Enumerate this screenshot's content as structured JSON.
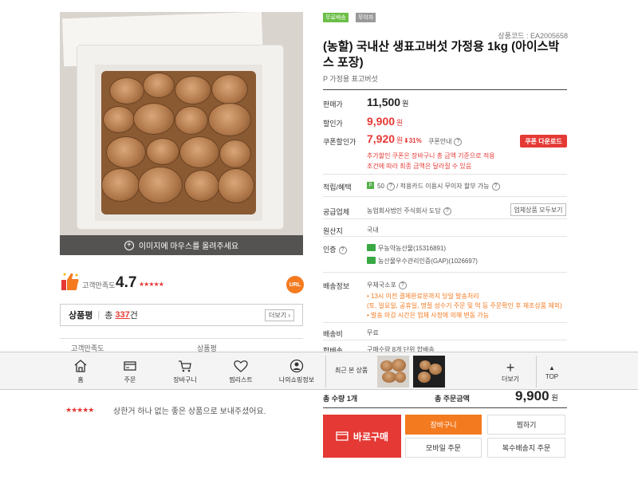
{
  "image": {
    "caption": "이미지에 마우스를 올려주세요"
  },
  "rating": {
    "label": "고객만족도",
    "value": "4.7",
    "stars": "★★★★★",
    "url_badge": "URL"
  },
  "reviews": {
    "title": "상품평",
    "total_prefix": "총",
    "count": "337",
    "suffix": "건",
    "more_label": "더보기 ›",
    "col_satisfaction": "고객만족도",
    "col_review": "상품평",
    "rows": [
      {
        "stars": "★★★★★",
        "text": "상한거 하나 없는 좋은 상품으로 보내주셨어요."
      }
    ]
  },
  "badges": [
    {
      "label": "무료배송",
      "color": "#6bbf47"
    },
    {
      "label": "무이자",
      "color": "#999999"
    }
  ],
  "product": {
    "code": "상품코드 : EA2005658",
    "title": "(농할) 국내산 생표고버섯 가정용 1kg (아이스박스 포장)",
    "subtitle": "P 가정용 표고버섯"
  },
  "pricing": {
    "normal_label": "판매가",
    "normal_price": "11,500",
    "currency": "원",
    "sale_label": "할인가",
    "sale_price": "9,900",
    "coupon_label": "쿠폰할인가",
    "coupon_price": "7,920",
    "discount": "⬇31%",
    "coupon_info": "쿠폰안내",
    "coupon_button": "쿠폰 다운로드",
    "coupon_note_1": "추가할인 쿠폰은 장바구니 총 금액 기준으로 적용",
    "coupon_note_2": "조건에 따라 최종 금액은 달라질 수 있음"
  },
  "benefits": {
    "label": "적립/혜택",
    "point_badge": "P",
    "point": "50",
    "card_text": "/ 적용카드 이용시 무이자 할부 가능"
  },
  "supplier": {
    "label": "공급업체",
    "value": "농업회사법인 주식회사 도담",
    "button": "업체상품 모두보기"
  },
  "origin": {
    "label": "원산지",
    "value": "국내"
  },
  "certification": {
    "label": "인증",
    "items": [
      "무농약농산물(15316891)",
      "농산물우수관리인증(GAP)(1026697)"
    ]
  },
  "shipping": {
    "label": "배송정보",
    "carrier": "우체국소포",
    "notes": [
      "• 13시 이전 결제완료분까지 당일 발송처리",
      "(토, 일요일, 공휴일, 명절 성수기 주문 및 억 등 주문확인 후 제조상품 제외)",
      "• 발송 마감 시간은 업체 사정에 의해 변동 가능"
    ],
    "fee_label": "배송비",
    "fee": "무료",
    "bundle_label": "합배송",
    "bundle": "구매수량 8개 단위 합배송"
  },
  "bottom_bar": {
    "items": [
      {
        "label": "홈",
        "icon": "home-icon"
      },
      {
        "label": "주문",
        "icon": "card-icon"
      },
      {
        "label": "장바구니",
        "icon": "cart-icon"
      },
      {
        "label": "찜리스트",
        "icon": "heart-icon"
      },
      {
        "label": "나의쇼핑정보",
        "icon": "user-icon"
      }
    ],
    "recent_label": "최근 본 상품",
    "more_label": "더보기",
    "top_label": "TOP"
  },
  "purchase": {
    "total_qty": "총 수량 1개",
    "total_label": "총 주문금액",
    "total_price": "9,900",
    "currency": "원",
    "buy_now": "바로구매",
    "cart": "장바구니",
    "wish": "찜하기",
    "mobile_order": "모바일 주문",
    "multi_ship": "복수배송지 주문"
  }
}
